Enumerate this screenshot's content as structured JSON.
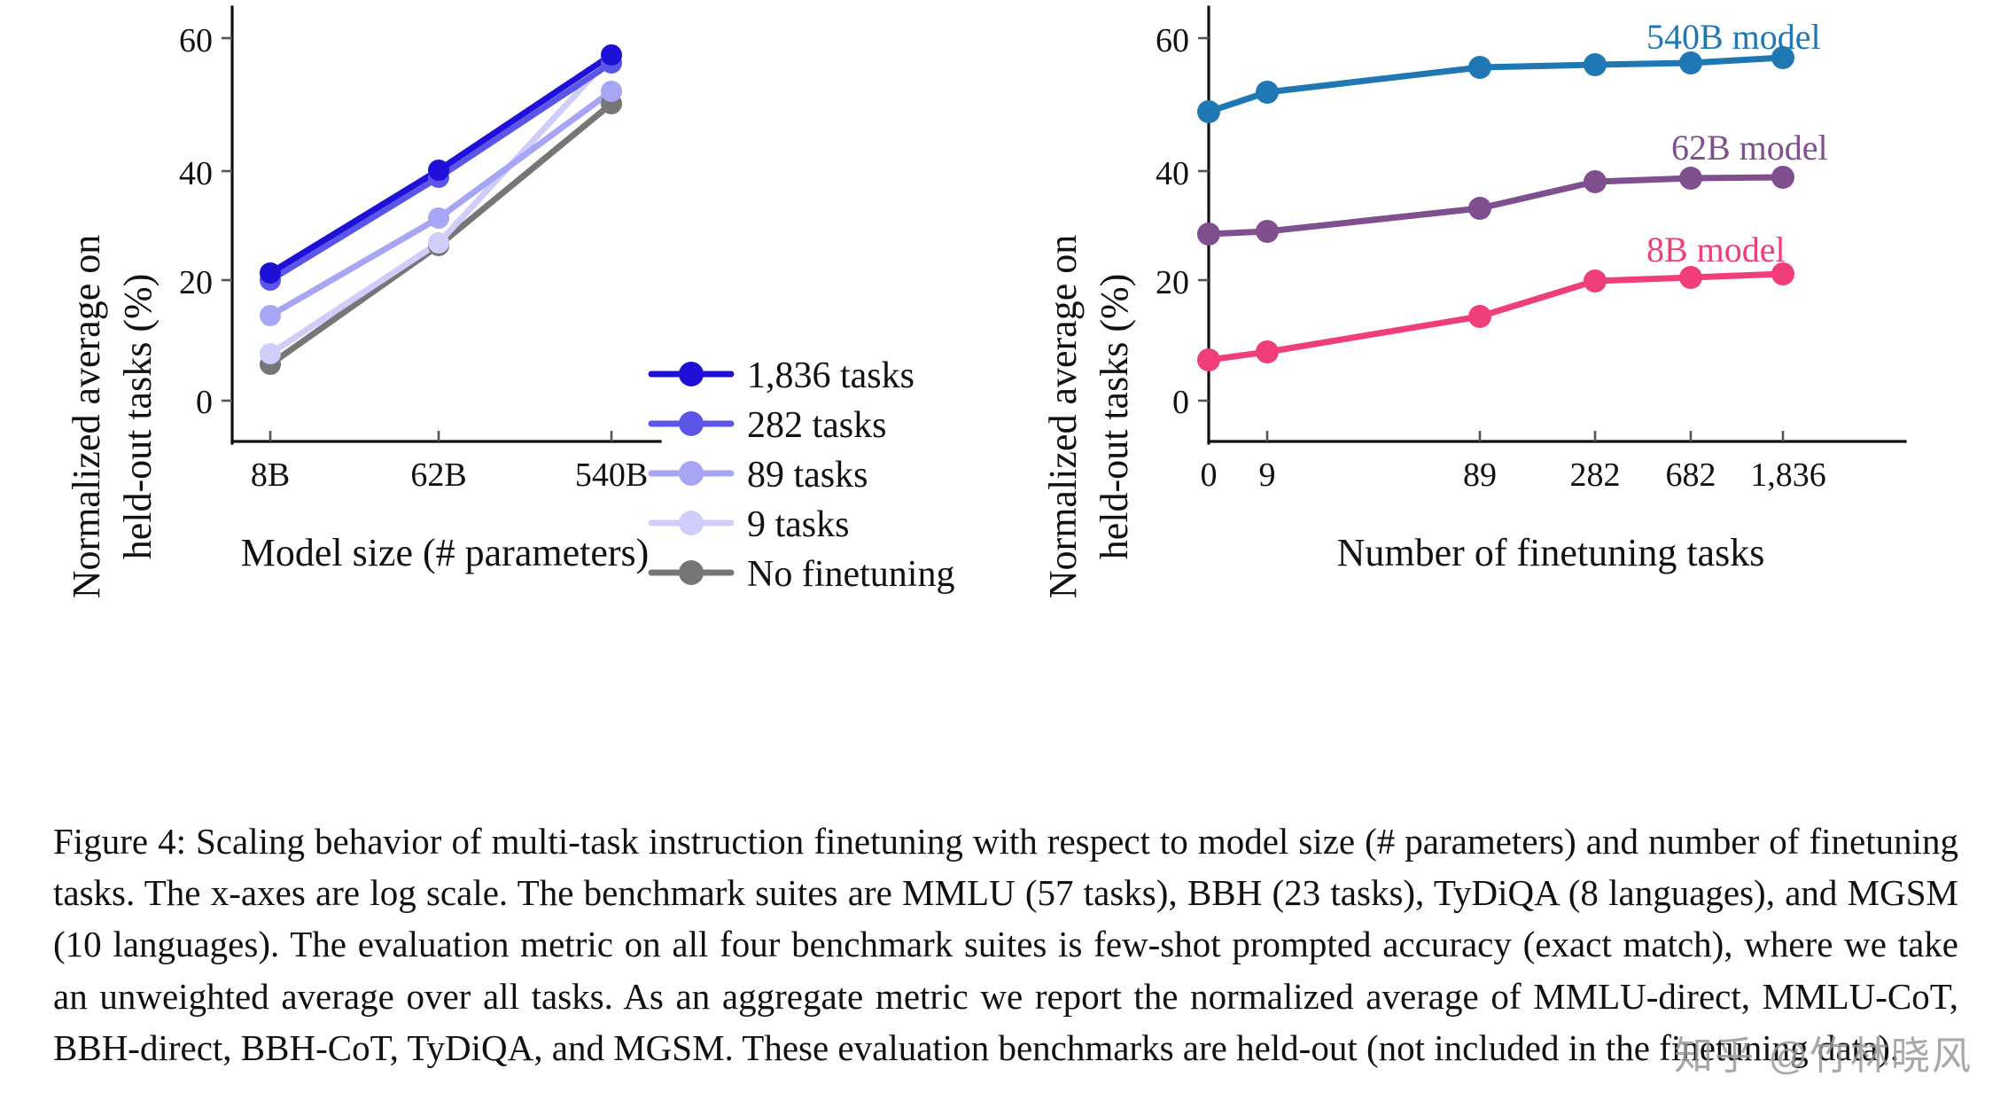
{
  "figure": {
    "caption_label": "Figure 4:",
    "caption_text": " Scaling behavior of multi-task instruction finetuning with respect to model size (# parameters) and number of finetuning tasks. The x-axes are log scale. The benchmark suites are MMLU (57 tasks), BBH (23 tasks), TyDiQA (8 languages), and MGSM (10 languages). The evaluation metric on all four benchmark suites is few-shot prompted accuracy (exact match), where we take an unweighted average over all tasks. As an aggregate metric we report the normalized average of MMLU-direct, MMLU-CoT, BBH-direct, BBH-CoT, TyDiQA, and MGSM. These evaluation benchmarks are held-out (not included in the finetuning data)."
  },
  "watermark": "知乎 @竹林晓风",
  "chart_data": [
    {
      "type": "line",
      "id": "left",
      "title": "",
      "xlabel": "Model size (# parameters)",
      "ylabel": "Normalized average on held-out tasks (%)",
      "ylabel_line1": "Normalized average on",
      "ylabel_line2": "held-out tasks (%)",
      "x_categories": [
        "8B",
        "62B",
        "540B"
      ],
      "x_log_scale": true,
      "xticks": [
        "8B",
        "62B",
        "540B"
      ],
      "yticks": [
        0,
        20,
        40,
        60
      ],
      "ylim": [
        -3,
        66
      ],
      "grid": false,
      "legend_position": "inside-lower-right",
      "series": [
        {
          "name": "1,836 tasks",
          "color": "#1f10d8",
          "values": [
            21.9,
            38.9,
            58.6
          ]
        },
        {
          "name": "282 tasks",
          "color": "#5b55e8",
          "values": [
            20.6,
            37.8,
            57.4
          ]
        },
        {
          "name": "89 tasks",
          "color": "#a7a6f4",
          "values": [
            14.8,
            33.3,
            52.6
          ]
        },
        {
          "name": "9 tasks",
          "color": "#cfcefb",
          "values": [
            8.4,
            28.7,
            56.9
          ]
        },
        {
          "name": "No finetuning",
          "color": "#767676",
          "values": [
            6.5,
            28.3,
            49.1
          ]
        }
      ]
    },
    {
      "type": "line",
      "id": "right",
      "title": "",
      "xlabel": "Number of finetuning tasks",
      "ylabel": "Normalized average on held-out tasks (%)",
      "ylabel_line1": "Normalized average on",
      "ylabel_line2": "held-out tasks (%)",
      "x_categories": [
        "0",
        "9",
        "89",
        "282",
        "682",
        "1,836"
      ],
      "x_values": [
        0,
        9,
        89,
        282,
        682,
        1836
      ],
      "x_log_scale": true,
      "xticks": [
        "0",
        "9",
        "89",
        "282",
        "682",
        "1,836"
      ],
      "yticks": [
        0,
        20,
        40,
        60
      ],
      "ylim": [
        -3,
        66
      ],
      "grid": false,
      "annotations": [
        {
          "text": "540B model",
          "color": "#1f77b4"
        },
        {
          "text": "62B model",
          "color": "#7f4f8f"
        },
        {
          "text": "8B model",
          "color": "#ef3e78"
        }
      ],
      "series": [
        {
          "name": "540B model",
          "color": "#1f77b4",
          "values": [
            49.3,
            52.6,
            57.0,
            57.5,
            57.8,
            58.5
          ]
        },
        {
          "name": "62B model",
          "color": "#7f4f8f",
          "values": [
            28.6,
            29.1,
            33.4,
            38.0,
            38.6,
            38.8
          ]
        },
        {
          "name": "8B model",
          "color": "#ef3e78",
          "values": [
            6.7,
            8.2,
            14.6,
            20.5,
            21.2,
            21.8
          ]
        }
      ]
    }
  ]
}
